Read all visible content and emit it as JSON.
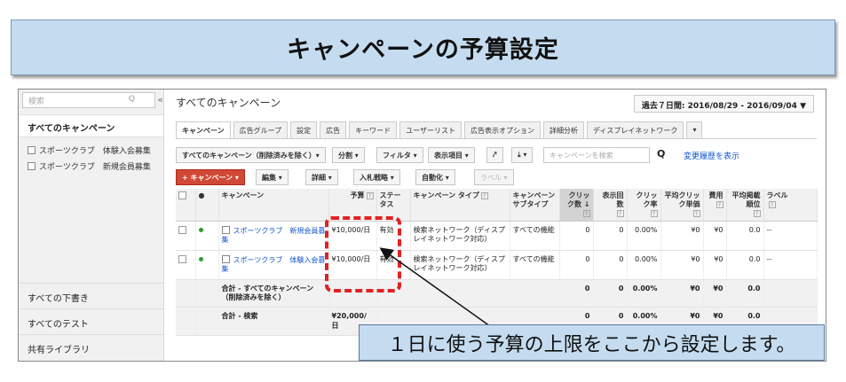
{
  "banner": {
    "title": "キャンペーンの予算設定"
  },
  "sidebar": {
    "search_placeholder": "検索",
    "search_icon": "Q",
    "collapse": "«",
    "all_campaigns": "すべてのキャンペーン",
    "campaigns": [
      "スポーツクラブ　体験入会募集",
      "スポーツクラブ　新規会員募集"
    ],
    "drafts": "すべての下書き",
    "tests": "すべてのテスト",
    "library": "共有ライブラリ"
  },
  "header": {
    "title": "すべてのキャンペーン",
    "date_range": "過去７日間: 2016/08/29 - 2016/09/04",
    "date_caret": "▼"
  },
  "tabs": [
    {
      "label": "キャンペーン"
    },
    {
      "label": "広告グループ"
    },
    {
      "label": "設定"
    },
    {
      "label": "広告"
    },
    {
      "label": "キーワード"
    },
    {
      "label": "ユーザーリスト"
    },
    {
      "label": "広告表示オプション"
    },
    {
      "label": "詳細分析"
    },
    {
      "label": "ディスプレイネットワーク"
    },
    {
      "label": "▾"
    }
  ],
  "toolbar": {
    "filter_all": "すべてのキャンペーン（削除済みを除く）▾",
    "segment": "分割 ▾",
    "filter": "フィルタ ▾",
    "columns": "表示項目 ▾",
    "chart_icon": "⤤",
    "download": "⤓ ▾",
    "search_placeholder": "キャンペーンを検索",
    "search_icon": "Q",
    "history": "変更履歴を表示",
    "add_campaign": "+ キャンペーン ▾",
    "edit": "編集 ▾",
    "details": "詳細 ▾",
    "bid_strategy": "入札戦略 ▾",
    "automate": "自動化 ▾",
    "labels": "ラベル ▾"
  },
  "table": {
    "headers": {
      "status_dot": "●",
      "campaign": "キャンペーン",
      "budget": "予算",
      "status": "ステータス",
      "campaign_type": "キャンペーン タイプ",
      "subtype": "キャンペーンサブタイプ",
      "clicks": "クリック数",
      "impressions": "表示回数",
      "ctr": "クリック率",
      "avg_cpc": "平均クリック単価",
      "cost": "費用",
      "avg_pos": "平均掲載順位",
      "labels": "ラベル",
      "help": "?",
      "sort": "↓"
    },
    "rows": [
      {
        "name": "スポーツクラブ　新規会員募集",
        "budget": "¥10,000/日",
        "status": "有効",
        "type": "検索ネットワーク（ディスプレイネットワーク対応）",
        "subtype": "すべての機能",
        "clicks": "0",
        "impr": "0",
        "ctr": "0.00%",
        "cpc": "¥0",
        "cost": "¥0",
        "pos": "0.0",
        "labels": "--"
      },
      {
        "name": "スポーツクラブ　体験入会募集",
        "budget": "¥10,000/日",
        "status": "有効",
        "type": "検索ネットワーク（ディスプレイネットワーク対応）",
        "subtype": "すべての機能",
        "clicks": "0",
        "impr": "0",
        "ctr": "0.00%",
        "cpc": "¥0",
        "cost": "¥0",
        "pos": "0.0",
        "labels": "--"
      }
    ],
    "total_all": {
      "label": "合計 - すべてのキャンペーン（削除済みを除く）",
      "clicks": "0",
      "impr": "0",
      "ctr": "0.00%",
      "cpc": "¥0",
      "cost": "¥0",
      "pos": "0.0"
    },
    "total_search": {
      "label": "合計 - 検索",
      "budget": "¥20,000/日",
      "clicks": "0",
      "impr": "0",
      "ctr": "0.00%",
      "cpc": "¥0",
      "cost": "¥0",
      "pos": "0.0"
    }
  },
  "callout": {
    "text": "１日に使う予算の上限をここから設定します。"
  },
  "colors": {
    "banner_bg": "#c5dcf0",
    "highlight": "#e02222",
    "link": "#1155cc",
    "add_button": "#d14836",
    "active_dot": "#2e9a2e"
  }
}
